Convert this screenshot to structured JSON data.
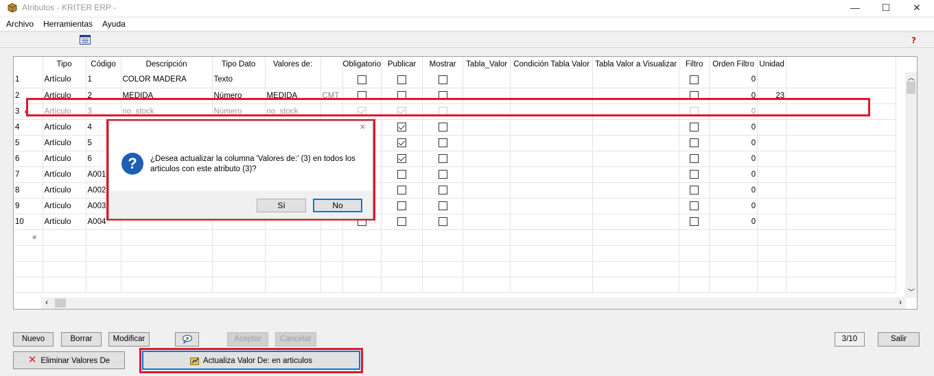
{
  "window": {
    "title": "Atributos - KRITER ERP -",
    "minimize": "—",
    "maximize": "☐",
    "close": "✕"
  },
  "menu": [
    "Archivo",
    "Herramientas",
    "Ayuda"
  ],
  "grid": {
    "columns": [
      "Tipo",
      "Código",
      "Descripción",
      "Tipo Dato",
      "Valores de:",
      "",
      "Obligatorio",
      "Publicar",
      "Mostrar",
      "Tabla_Valor",
      "Condición Tabla Valor",
      "Tabla Valor a Visualizar",
      "Filtro",
      "Orden Filtro",
      "Unidad"
    ],
    "rows": [
      {
        "n": "1",
        "tipo": "Artículo",
        "codigo": "1",
        "desc": "COLOR MADERA",
        "tipo_dato": "Texto",
        "valores": "",
        "unit_code": "",
        "oblig": false,
        "publ": false,
        "most": false,
        "filtro": false,
        "orden": "0",
        "unidad": ""
      },
      {
        "n": "2",
        "tipo": "Artículo",
        "codigo": "2",
        "desc": "MEDIDA",
        "tipo_dato": "Número",
        "valores": "MEDIDA",
        "unit_code": "CMT",
        "oblig": false,
        "publ": false,
        "most": false,
        "filtro": false,
        "orden": "0",
        "unidad": "23"
      },
      {
        "n": "3",
        "tipo": "Artículo",
        "codigo": "3",
        "desc": "no_stock",
        "tipo_dato": "Número",
        "valores": "no_stock",
        "unit_code": "",
        "oblig": true,
        "publ": true,
        "most": false,
        "filtro": false,
        "orden": "0",
        "unidad": ""
      },
      {
        "n": "4",
        "tipo": "Artículo",
        "codigo": "4",
        "desc": "",
        "tipo_dato": "",
        "valores": "",
        "unit_code": "",
        "oblig": false,
        "publ": true,
        "most": false,
        "filtro": false,
        "orden": "0",
        "unidad": ""
      },
      {
        "n": "5",
        "tipo": "Artículo",
        "codigo": "5",
        "desc": "",
        "tipo_dato": "",
        "valores": "",
        "unit_code": "",
        "oblig": false,
        "publ": true,
        "most": false,
        "filtro": false,
        "orden": "0",
        "unidad": ""
      },
      {
        "n": "6",
        "tipo": "Artículo",
        "codigo": "6",
        "desc": "",
        "tipo_dato": "",
        "valores": "",
        "unit_code": "",
        "oblig": false,
        "publ": true,
        "most": false,
        "filtro": false,
        "orden": "0",
        "unidad": ""
      },
      {
        "n": "7",
        "tipo": "Artículo",
        "codigo": "A001",
        "desc": "",
        "tipo_dato": "",
        "valores": "",
        "unit_code": "",
        "oblig": false,
        "publ": false,
        "most": false,
        "filtro": false,
        "orden": "0",
        "unidad": ""
      },
      {
        "n": "8",
        "tipo": "Artículo",
        "codigo": "A002",
        "desc": "",
        "tipo_dato": "",
        "valores": "",
        "unit_code": "",
        "oblig": false,
        "publ": false,
        "most": false,
        "filtro": false,
        "orden": "0",
        "unidad": ""
      },
      {
        "n": "9",
        "tipo": "Artículo",
        "codigo": "A003",
        "desc": "",
        "tipo_dato": "",
        "valores": "",
        "unit_code": "",
        "oblig": false,
        "publ": false,
        "most": false,
        "filtro": false,
        "orden": "0",
        "unidad": ""
      },
      {
        "n": "10",
        "tipo": "Artículo",
        "codigo": "A004",
        "desc": "",
        "tipo_dato": "",
        "valores": "",
        "unit_code": "",
        "oblig": false,
        "publ": false,
        "most": false,
        "filtro": false,
        "orden": "0",
        "unidad": ""
      }
    ],
    "selected_row": 3,
    "new_row_marker": "✳"
  },
  "dialog": {
    "message": "¿Desea actualizar la columna 'Valores de:' (3) en todos los articulos con este atributo (3)?",
    "yes": "Sí",
    "no": "No",
    "close": "✕",
    "icon": "?"
  },
  "buttons": {
    "nuevo": "Nuevo",
    "borrar": "Borrar",
    "modificar": "Modificar",
    "aceptar": "Aceptar",
    "cancelar": "Cancelar",
    "eliminar": "Eliminar Valores De",
    "actualiza": "Actualiza Valor De: en articulos",
    "salir": "Salir"
  },
  "counter": "3/10",
  "colors": {
    "highlight": "#e0162b",
    "accent": "#0078d7"
  }
}
